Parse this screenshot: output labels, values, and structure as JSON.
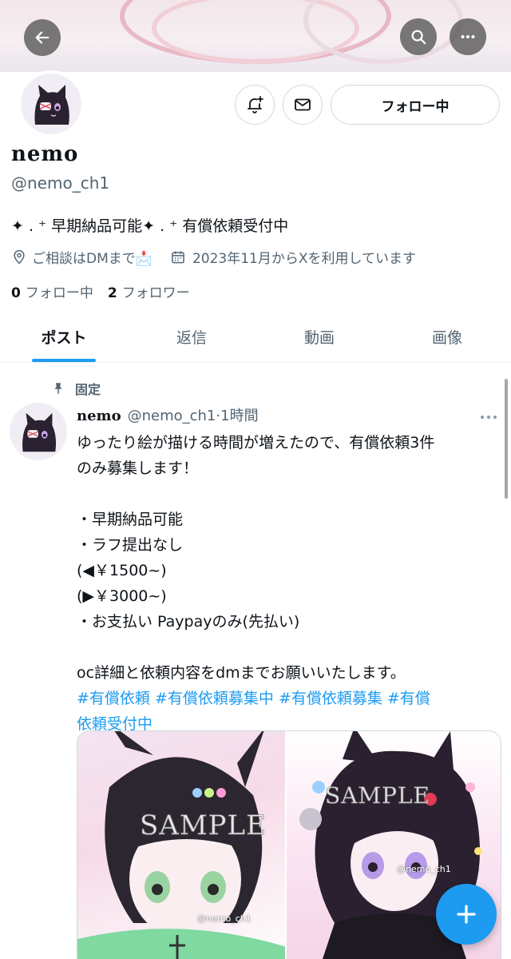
{
  "profile": {
    "display_name": "nemo",
    "handle": "@nemo_ch1",
    "bio": "✦ . ⁺ 早期納品可能✦ . ⁺ 有償依頼受付中",
    "location": "ご相談はDMまで📩",
    "joined": "2023年11月からXを利用しています",
    "following_count": "0",
    "following_label": "フォロー中",
    "followers_count": "2",
    "followers_label": "フォロワー",
    "follow_button_label": "フォロー中"
  },
  "tabs": [
    {
      "label": "ポスト",
      "active": true
    },
    {
      "label": "返信",
      "active": false
    },
    {
      "label": "動画",
      "active": false
    },
    {
      "label": "画像",
      "active": false
    }
  ],
  "pinned_post": {
    "pinned_label": "固定",
    "author_name": "nemo",
    "author_handle": "@nemo_ch1",
    "separator": "·",
    "time": "1時間",
    "lines": [
      "ゆったり絵が描ける時間が増えたので、有償依頼3件",
      "のみ募集します！",
      "",
      "・早期納品可能",
      "・ラフ提出なし",
      "(◀︎￥1500~)",
      "(▶︎￥3000~)",
      "・お支払い Paypayのみ(先払い)",
      "",
      "oc詳細と依頼内容をdmまでお願いいたします。"
    ],
    "hashtag_lines": [
      "#有償依頼  #有償依頼募集中 #有償依頼募集 #有償",
      "依頼受付中"
    ],
    "media": [
      {
        "overlay": "SAMPLE",
        "watermark": "@nemo_ch1"
      },
      {
        "overlay": "SAMPLE",
        "watermark": "@nemo_ch1"
      }
    ]
  },
  "icons": {
    "back": "arrow-left-icon",
    "search": "search-icon",
    "more": "more-horizontal-icon",
    "notify": "bell-plus-icon",
    "mail": "envelope-icon",
    "location": "location-pin-icon",
    "calendar": "calendar-icon",
    "pin": "pin-icon",
    "compose": "plus-icon"
  },
  "colors": {
    "accent": "#1d9bf0",
    "text_secondary": "#536471",
    "border": "#cfd9de"
  }
}
